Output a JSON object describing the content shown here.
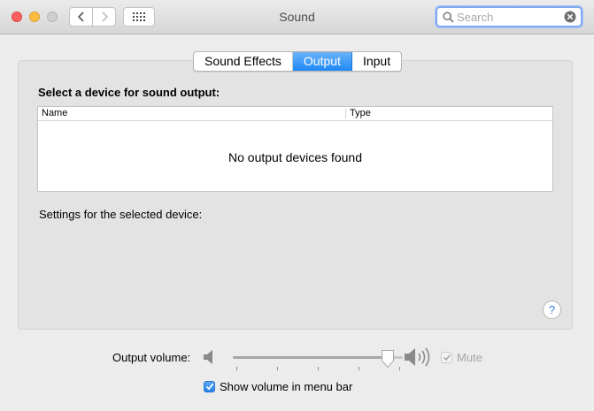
{
  "window": {
    "title": "Sound"
  },
  "search": {
    "placeholder": "Search",
    "value": ""
  },
  "tabs": [
    {
      "label": "Sound Effects",
      "selected": false
    },
    {
      "label": "Output",
      "selected": true
    },
    {
      "label": "Input",
      "selected": false
    }
  ],
  "output": {
    "heading": "Select a device for sound output:",
    "columns": [
      "Name",
      "Type"
    ],
    "empty_message": "No output devices found",
    "settings_label": "Settings for the selected device:",
    "help_label": "?"
  },
  "volume": {
    "label": "Output volume:",
    "level": 0.91,
    "mute_label": "Mute",
    "mute_checked": true,
    "mute_enabled": false
  },
  "menubar": {
    "label": "Show volume in menu bar",
    "checked": true
  },
  "colors": {
    "accent": "#1e88f5",
    "search_focus": "#7faaf0"
  },
  "icons": [
    "back-icon",
    "forward-icon",
    "grid-icon",
    "search-icon",
    "clear-icon",
    "speaker-low-icon",
    "speaker-high-icon",
    "help-icon"
  ]
}
